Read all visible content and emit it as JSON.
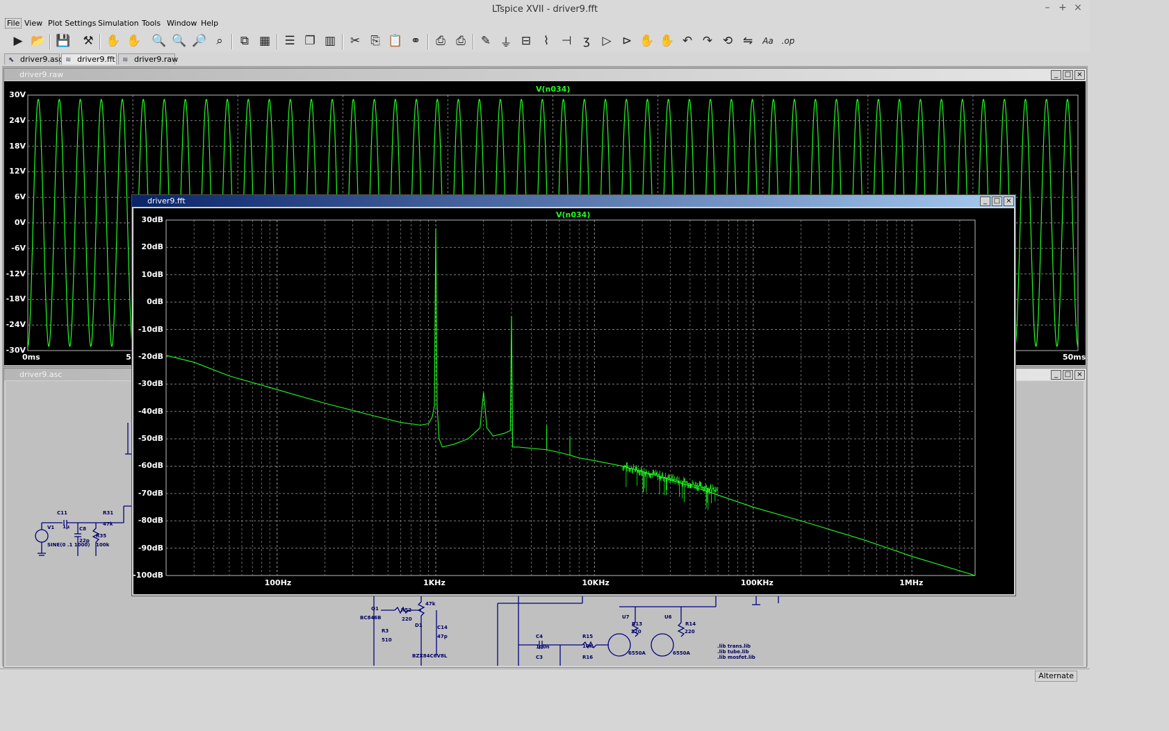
{
  "app": {
    "title": "LTspice XVII - driver9.fft",
    "window_buttons": [
      "–",
      "+",
      "×"
    ]
  },
  "menu": [
    "File",
    "View",
    "Plot Settings",
    "Simulation",
    "Tools",
    "Window",
    "Help"
  ],
  "toolbar_icons": [
    "run-icon",
    "open-icon",
    "save-icon",
    "control-panel-icon",
    "halt-icon",
    "pan-icon",
    "zoom-in-icon",
    "zoom-area-icon",
    "zoom-out-icon",
    "zoom-fit-icon",
    "autorange-icon",
    "grid-icon",
    "tile-horizontal-icon",
    "cascade-icon",
    "tile-vertical-icon",
    "cut-icon",
    "copy-icon",
    "paste-icon",
    "find-icon",
    "print-icon",
    "print-preview-icon",
    "wire-icon",
    "ground-icon",
    "label-icon",
    "resistor-icon",
    "capacitor-icon",
    "inductor-icon",
    "diode-icon",
    "component-icon",
    "move-icon",
    "drag-icon",
    "undo-icon",
    "redo-icon",
    "rotate-icon",
    "mirror-icon",
    "text-icon",
    "spice-directive-icon"
  ],
  "tabs": [
    {
      "label": "driver9.asc",
      "icon": "schematic-icon"
    },
    {
      "label": "driver9.fft",
      "icon": "waveform-icon"
    },
    {
      "label": "driver9.raw",
      "icon": "waveform-icon"
    }
  ],
  "raw_window": {
    "title": "driver9.raw",
    "trace": "V(n034)",
    "y_ticks": [
      "30V",
      "24V",
      "18V",
      "12V",
      "6V",
      "0V",
      "-6V",
      "-12V",
      "-18V",
      "-24V",
      "-30V"
    ],
    "x_ticks": [
      "0ms",
      "5ms",
      "50ms"
    ],
    "colors": {
      "trace": "#20ff20",
      "background": "#000000",
      "grid": "#808080"
    }
  },
  "asc_window": {
    "title": "driver9.asc",
    "labels": [
      "C11",
      "1µ",
      "V1",
      "SINE(0 .1 1000)",
      "C8",
      "22p",
      "R31",
      "47k",
      "R35",
      "100k",
      "Q1",
      "BC846B",
      "R52",
      "220",
      "R23",
      "47k",
      "R3",
      "510",
      "D1",
      "BZX84C6V8L",
      "C14",
      "47p",
      "C4",
      "100n",
      "C3",
      "R15",
      "10K",
      "R16",
      "U7",
      "6550A",
      "R13",
      "220",
      "U6",
      "6550A",
      "R14",
      "220",
      ".lib trans.lib",
      ".lib tube.lib",
      ".lib mosfet.lib",
      "8"
    ]
  },
  "fft_window": {
    "title": "driver9.fft",
    "trace": "V(n034)",
    "y_ticks": [
      "30dB",
      "20dB",
      "10dB",
      "0dB",
      "-10dB",
      "-20dB",
      "-30dB",
      "-40dB",
      "-50dB",
      "-60dB",
      "-70dB",
      "-80dB",
      "-90dB",
      "-100dB"
    ],
    "x_ticks": [
      "100Hz",
      "1KHz",
      "10KHz",
      "100KHz",
      "1MHz"
    ]
  },
  "status": {
    "mode": "Alternate"
  },
  "chart_data": [
    {
      "type": "line",
      "title": "V(n034)",
      "xlabel": "",
      "ylabel": "",
      "x_unit": "ms",
      "xlim": [
        0,
        50
      ],
      "ylim": [
        -30,
        30
      ],
      "grid": true,
      "series": [
        {
          "name": "V(n034)",
          "frequency_hz": 1000,
          "amplitude_v": 29,
          "offset_v": 0
        }
      ]
    },
    {
      "type": "line",
      "title": "V(n034)",
      "xlabel": "",
      "ylabel": "",
      "x_scale": "log",
      "xlim_hz": [
        20,
        2500000
      ],
      "ylim_db": [
        -100,
        30
      ],
      "grid": true,
      "series": [
        {
          "name": "V(n034)",
          "x_hz": [
            20,
            30,
            50,
            100,
            200,
            400,
            600,
            800,
            900,
            950,
            980,
            1000,
            1020,
            1050,
            1100,
            1300,
            1600,
            1900,
            2000,
            2100,
            2300,
            2700,
            2950,
            3000,
            3050,
            3300,
            4000,
            5000,
            5000,
            5000,
            6000,
            7000,
            7000,
            7000,
            8000,
            10000,
            15000,
            20000,
            30000,
            50000,
            100000,
            200000,
            500000,
            1000000,
            2500000
          ],
          "y_db": [
            -19.5,
            -22,
            -27,
            -32,
            -37,
            -41.5,
            -44,
            -45,
            -44.5,
            -42,
            -38,
            27,
            -38,
            -50,
            -53,
            -52,
            -50,
            -46,
            -33,
            -46,
            -49,
            -48,
            -47,
            -5,
            -53,
            -53,
            -53.5,
            -54,
            -45,
            -54,
            -55,
            -56,
            -49,
            -56,
            -57,
            -58,
            -60,
            -62,
            -65,
            -69,
            -75,
            -80,
            -87,
            -93,
            -100
          ]
        }
      ]
    }
  ]
}
